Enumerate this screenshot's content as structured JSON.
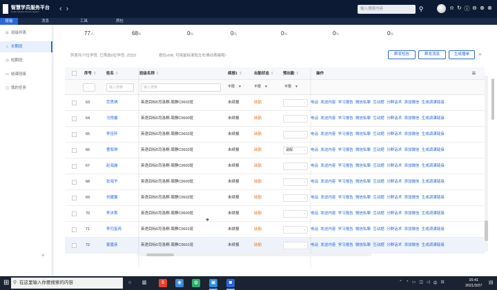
{
  "app": {
    "title": "智慧学员服务平台",
    "subtitle": "Smart Student Service System",
    "search_placeholder": "输入搜索内容"
  },
  "nav_tabs": [
    "班级",
    "消息",
    "工具",
    "质检"
  ],
  "sidebar": {
    "header": "班级列表",
    "items": [
      "长期班",
      "短期班",
      "结课班级",
      "我的任务"
    ]
  },
  "stats": [
    {
      "value": "77",
      "unit": "人"
    },
    {
      "value": "68",
      "unit": "%"
    },
    {
      "value": "0",
      "unit": "%"
    },
    {
      "value": "0",
      "unit": "%"
    },
    {
      "value": "0",
      "unit": "%"
    },
    {
      "value": "0",
      "unit": "%"
    },
    {
      "value": "0",
      "unit": "%"
    }
  ],
  "info": {
    "summary": "列表共77位学员, 已筛选0位学员, 占比0",
    "hint": "按住shift, 可用鼠标滚轮左右滑动表格哦~"
  },
  "buttons": [
    "群发短信",
    "群发消息",
    "生成播单"
  ],
  "columns": [
    "序号",
    "姓名",
    "班级名称",
    "续报1",
    "出勤状态",
    "预出勤",
    "操作"
  ],
  "filters": {
    "name_placeholder": "输入搜索",
    "class_placeholder": "输入搜索",
    "renew": "不限",
    "attendance": "不限",
    "pre_attendance": "不限"
  },
  "rows": [
    {
      "no": "63",
      "name": "范思琪",
      "class": "英语目标5司洛桐-周静C0602班",
      "renew": "未续报",
      "status": "缺勤",
      "pre": ""
    },
    {
      "no": "64",
      "name": "马悦馨",
      "class": "英语目标5司洛桐-周静C0600班",
      "renew": "未续报",
      "status": "缺勤",
      "pre": ""
    },
    {
      "no": "65",
      "name": "李佳轩",
      "class": "英语目标5司洛桐-周静C0602班",
      "renew": "未续报",
      "status": "缺勤",
      "pre": ""
    },
    {
      "no": "66",
      "name": "曹叙琪",
      "class": "英语目标5司洛桐-周静C0602班",
      "renew": "未续报",
      "status": "缺勤",
      "pre": "请假"
    },
    {
      "no": "67",
      "name": "赵海露",
      "class": "英语目标5司洛桐-周静C0600班",
      "renew": "未续报",
      "status": "缺勤",
      "pre": ""
    },
    {
      "no": "68",
      "name": "张海予",
      "class": "英语目标5司洛桐-周静C0600班",
      "renew": "未续报",
      "status": "缺勤",
      "pre": ""
    },
    {
      "no": "69",
      "name": "刘媛馨",
      "class": "英语目标5司洛桐-周静C0602班",
      "renew": "未续报",
      "status": "缺勤",
      "pre": ""
    },
    {
      "no": "70",
      "name": "李沐宥",
      "class": "英语目标5司洛桐-周静C0600班",
      "renew": "未续报",
      "status": "缺勤",
      "pre": ""
    },
    {
      "no": "71",
      "name": "李司富芮",
      "class": "英语目标5司洛桐-周静C0601班",
      "renew": "未续报",
      "status": "缺勤",
      "pre": ""
    },
    {
      "no": "72",
      "name": "姜嘉彦",
      "class": "英语目标5司洛桐-周静C0601班",
      "renew": "未续报",
      "status": "缺勤",
      "pre": ""
    }
  ],
  "row_actions": [
    "电话",
    "发送内容",
    "学习报告",
    "微信私聊",
    "互动题",
    "分群话术",
    "添加微信",
    "生成调课链接"
  ],
  "taskbar": {
    "search_placeholder": "在这里输入你要搜索的内容",
    "time": "15:41",
    "date": "2021/3/27",
    "ime": "中"
  },
  "colors": {
    "accent": "#2b66d9",
    "header_bg": "#0d1a33",
    "absent": "#e8792a"
  }
}
